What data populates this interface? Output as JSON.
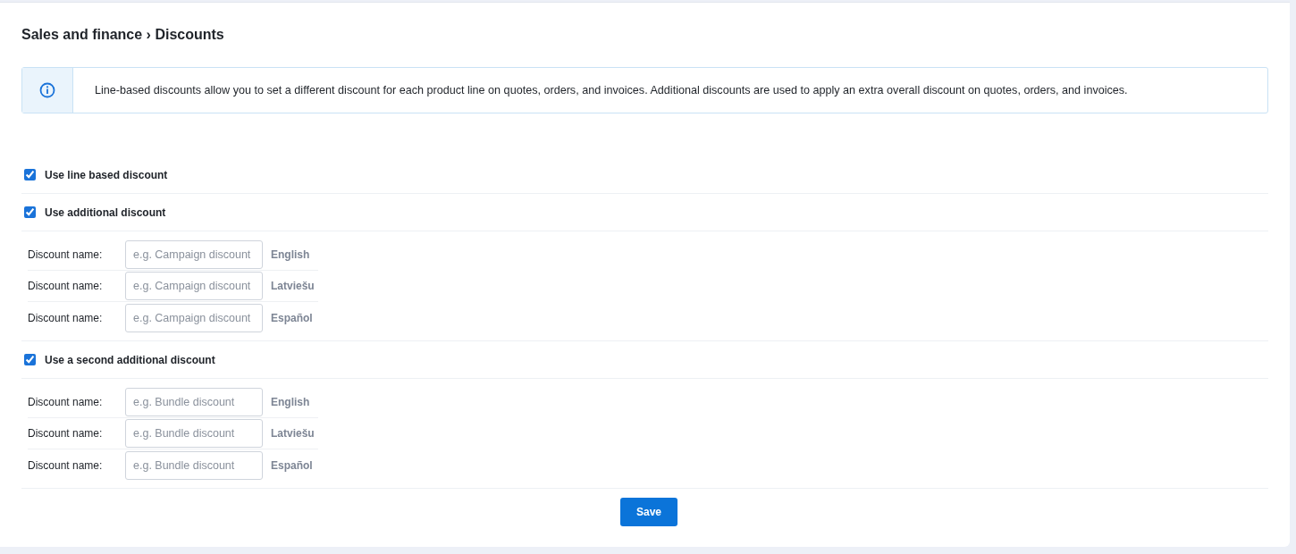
{
  "breadcrumb": "Sales and finance › Discounts",
  "info": "Line-based discounts allow you to set a different discount for each product line on quotes, orders, and invoices. Additional discounts are used to apply an extra overall discount on quotes, orders, and invoices.",
  "options": [
    {
      "label": "Use line based discount",
      "checked": true
    },
    {
      "label": "Use additional discount",
      "checked": true,
      "fields": [
        {
          "label": "Discount name:",
          "placeholder": "e.g. Campaign discount",
          "language": "English"
        },
        {
          "label": "Discount name:",
          "placeholder": "e.g. Campaign discount",
          "language": "Latviešu"
        },
        {
          "label": "Discount name:",
          "placeholder": "e.g. Campaign discount",
          "language": "Español"
        }
      ]
    },
    {
      "label": "Use a second additional discount",
      "checked": true,
      "fields": [
        {
          "label": "Discount name:",
          "placeholder": "e.g. Bundle discount",
          "language": "English"
        },
        {
          "label": "Discount name:",
          "placeholder": "e.g. Bundle discount",
          "language": "Latviešu"
        },
        {
          "label": "Discount name:",
          "placeholder": "e.g. Bundle discount",
          "language": "Español"
        }
      ]
    }
  ],
  "save_button": "Save"
}
